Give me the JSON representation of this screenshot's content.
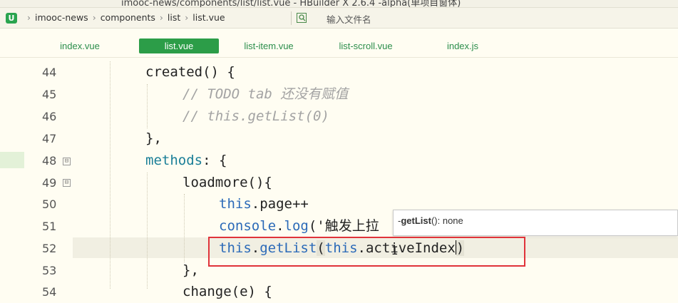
{
  "window": {
    "title": "imooc-news/components/list/list.vue - HBuilder X 2.6.4 -alpha(单项目窗体)"
  },
  "addressbar": {
    "app_icon": "U",
    "breadcrumb": [
      "imooc-news",
      "components",
      "list",
      "list.vue"
    ],
    "separator": "›",
    "search_placeholder": "输入文件名"
  },
  "tabs": [
    {
      "label": "index.vue",
      "active": false
    },
    {
      "label": "list.vue",
      "active": true
    },
    {
      "label": "list-item.vue",
      "active": false
    },
    {
      "label": "list-scroll.vue",
      "active": false
    },
    {
      "label": "index.js",
      "active": false
    }
  ],
  "editor": {
    "line_numbers": [
      "44",
      "45",
      "46",
      "47",
      "48",
      "49",
      "50",
      "51",
      "52",
      "53",
      "54"
    ],
    "fold_marker": "⊟",
    "lines": {
      "l44": "created() {",
      "l45": "// TODO tab 还没有赋值",
      "l46": "// this.getList(0)",
      "l47": "},",
      "l48_key": "methods",
      "l48_rest": ": {",
      "l49": "loadmore(){",
      "l50_this": "this",
      "l50_rest": ".page++",
      "l51_obj": "console",
      "l51_dot": ".",
      "l51_fn": "log",
      "l51_rest": "('触发上拉",
      "l52_this": "this",
      "l52_dot": ".",
      "l52_fn": "getList",
      "l52_open": "(",
      "l52_this2": "this",
      "l52_arg": ".activeIndex",
      "l52_close": ")",
      "l53": "},",
      "l54": "change(e) {"
    },
    "hint": {
      "name": "getList",
      "rest": "(): none",
      "prefix": "-"
    }
  }
}
